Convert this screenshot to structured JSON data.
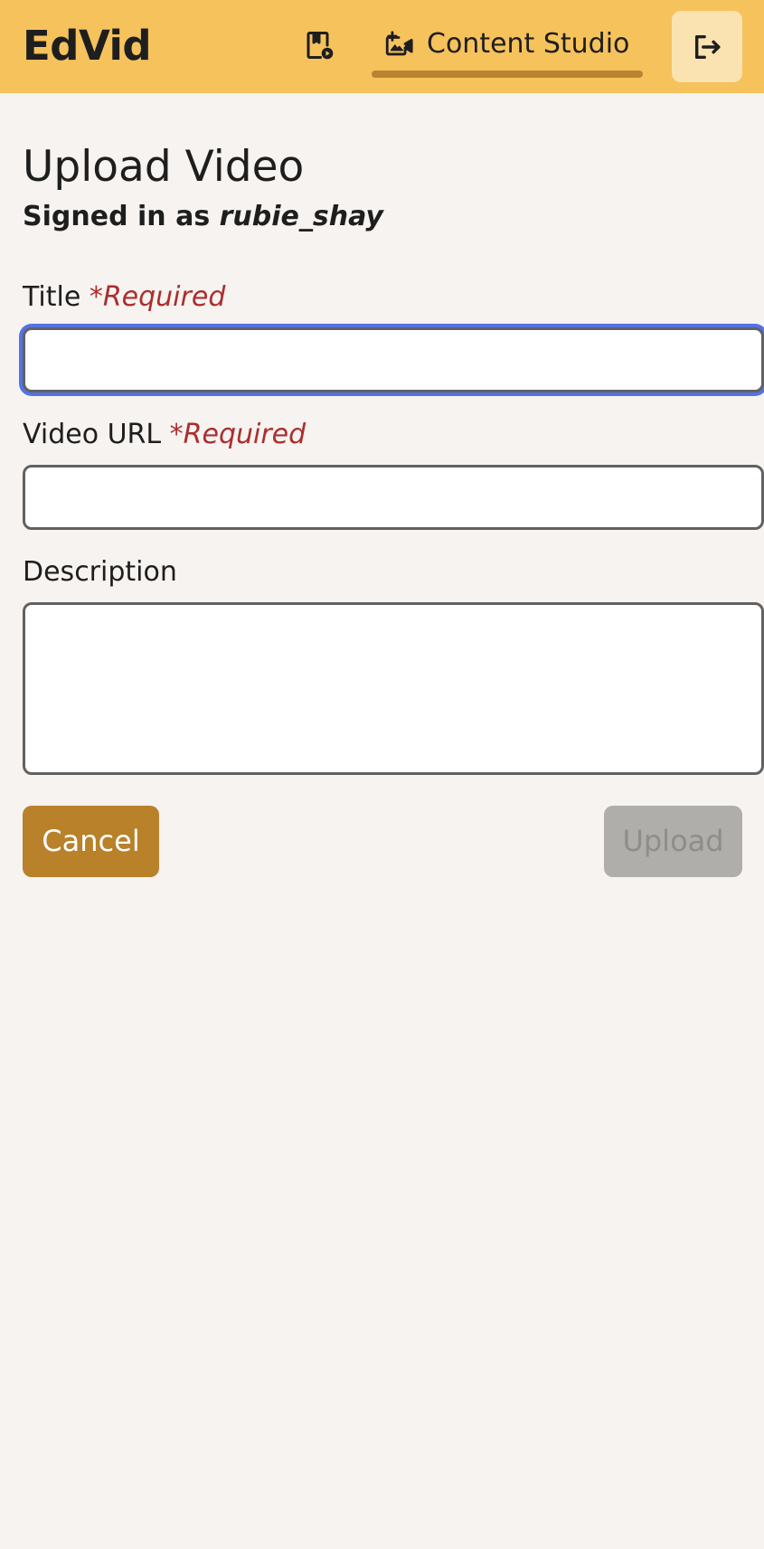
{
  "app": {
    "brand": "EdVid"
  },
  "nav": {
    "videos_icon": "video-library-icon",
    "studio_icon": "add-video-icon",
    "studio_label": "Content Studio",
    "logout_icon": "logout-icon"
  },
  "page": {
    "title": "Upload Video",
    "signed_in_prefix": "Signed in as ",
    "username": "rubie_shay"
  },
  "form": {
    "title_label": "Title ",
    "title_required": "*Required",
    "title_value": "",
    "url_label": "Video URL ",
    "url_required": "*Required",
    "url_value": "",
    "description_label": "Description",
    "description_value": ""
  },
  "buttons": {
    "cancel": "Cancel",
    "upload": "Upload"
  },
  "colors": {
    "header_bg": "#f6c25c",
    "accent": "#b8812a",
    "required": "#ab2e2e",
    "focus_ring": "#5472e6",
    "disabled_button": "#b0aeab"
  }
}
